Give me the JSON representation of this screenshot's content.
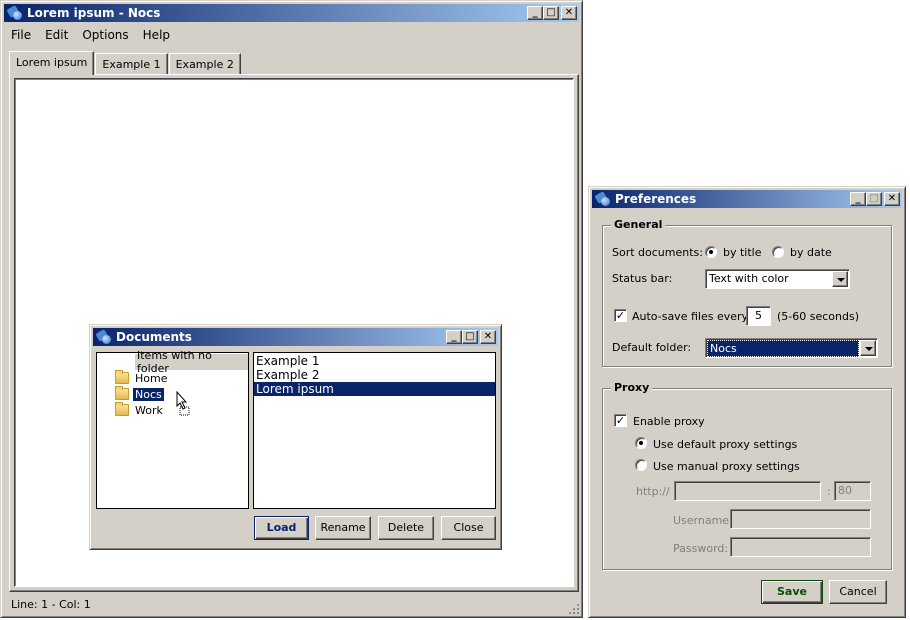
{
  "main_window": {
    "title": "Lorem ipsum - Nocs",
    "menu": [
      "File",
      "Edit",
      "Options",
      "Help"
    ],
    "tabs": [
      {
        "label": "Lorem ipsum",
        "active": true
      },
      {
        "label": "Example 1",
        "active": false
      },
      {
        "label": "Example 2",
        "active": false
      }
    ],
    "status": "Line: 1 - Col: 1",
    "window_buttons": {
      "minimize": "_",
      "maximize": "□",
      "close": "✕"
    }
  },
  "documents_dialog": {
    "title": "Documents",
    "tree": [
      {
        "label": "Items with no folder",
        "icon": "none",
        "highlighted": true
      },
      {
        "label": "Home",
        "icon": "folder-icon"
      },
      {
        "label": "Nocs",
        "icon": "folder-icon",
        "selected": true
      },
      {
        "label": "Work",
        "icon": "folder-icon"
      }
    ],
    "documents": [
      {
        "label": "Example 1"
      },
      {
        "label": "Example 2"
      },
      {
        "label": "Lorem ipsum",
        "selected": true
      }
    ],
    "buttons": {
      "load": "Load",
      "rename": "Rename",
      "delete": "Delete",
      "close": "Close"
    }
  },
  "preferences_dialog": {
    "title": "Preferences",
    "general": {
      "legend": "General",
      "sort_label": "Sort documents:",
      "sort_options": [
        {
          "label": "by title",
          "checked": true
        },
        {
          "label": "by date",
          "checked": false
        }
      ],
      "status_bar_label": "Status bar:",
      "status_bar_value": "Text with color",
      "autosave_label": "Auto-save files every:",
      "autosave_checked": true,
      "autosave_value": "5",
      "autosave_hint": "(5-60 seconds)",
      "default_folder_label": "Default folder:",
      "default_folder_value": "Nocs"
    },
    "proxy": {
      "legend": "Proxy",
      "enable_label": "Enable proxy",
      "enable_checked": true,
      "default_settings_label": "Use default proxy settings",
      "default_settings_checked": true,
      "manual_settings_label": "Use manual proxy settings",
      "manual_settings_checked": false,
      "http_label": "http://",
      "host_value": "",
      "port_separator": ":",
      "port_value": "80",
      "username_label": "Username:",
      "username_value": "",
      "password_label": "Password:",
      "password_value": ""
    },
    "buttons": {
      "save": "Save",
      "cancel": "Cancel"
    }
  },
  "colors": {
    "selection": "#0a246a",
    "window_bg": "#d4d0c8",
    "save_text": "#0a4a0a",
    "load_text": "#0a246a"
  }
}
